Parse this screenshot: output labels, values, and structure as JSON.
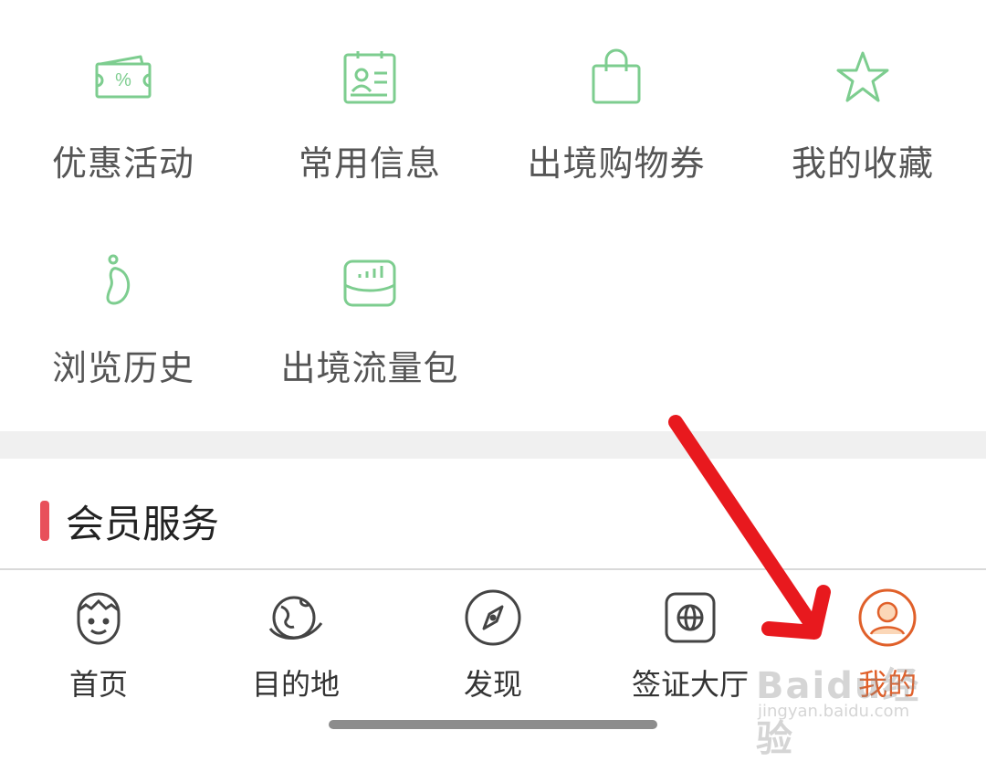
{
  "grid": {
    "items": [
      {
        "label": "优惠活动",
        "icon": "coupon-icon"
      },
      {
        "label": "常用信息",
        "icon": "id-card-icon"
      },
      {
        "label": "出境购物券",
        "icon": "shopping-bag-icon"
      },
      {
        "label": "我的收藏",
        "icon": "star-icon"
      },
      {
        "label": "浏览历史",
        "icon": "footprint-icon"
      },
      {
        "label": "出境流量包",
        "icon": "data-package-icon"
      }
    ],
    "icon_color": "#7dcd8f"
  },
  "section": {
    "title": "会员服务",
    "accent_color": "#e8505b"
  },
  "tabbar": {
    "tabs": [
      {
        "label": "首页",
        "icon": "home-face-icon",
        "active": false
      },
      {
        "label": "目的地",
        "icon": "globe-icon",
        "active": false
      },
      {
        "label": "发现",
        "icon": "compass-icon",
        "active": false
      },
      {
        "label": "签证大厅",
        "icon": "visa-globe-icon",
        "active": false
      },
      {
        "label": "我的",
        "icon": "profile-icon",
        "active": true
      }
    ],
    "active_color": "#e0602a"
  },
  "annotation": {
    "type": "red-arrow",
    "color": "#e8191e"
  },
  "watermark": {
    "brand": "Baidu经验",
    "url": "jingyan.baidu.com"
  }
}
